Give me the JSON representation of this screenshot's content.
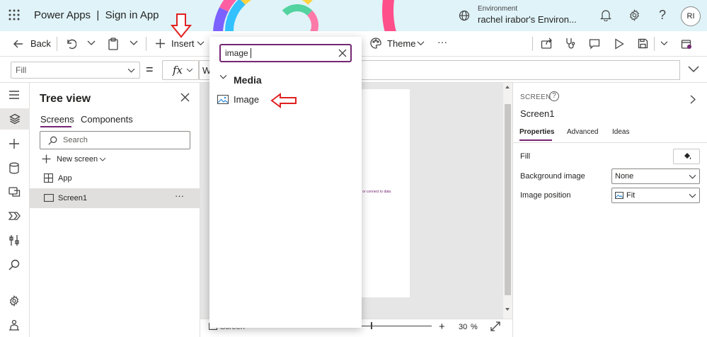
{
  "header": {
    "app_title": "Power Apps  |  Sign in App",
    "environment_label": "Environment",
    "environment_name": "rachel irabor's Environ...",
    "help": "?",
    "avatar_initials": "RI"
  },
  "toolbar": {
    "back_label": "Back",
    "insert_label": "Insert",
    "theme_label": "Theme",
    "more": "···"
  },
  "formula_bar": {
    "property": "Fill",
    "equals": "=",
    "fx": "fx",
    "formula_value": "Wh"
  },
  "tree_view": {
    "title": "Tree view",
    "tabs": [
      {
        "label": "Screens"
      },
      {
        "label": "Components"
      }
    ],
    "search_placeholder": "Search",
    "new_screen_label": "New screen",
    "items": [
      {
        "label": "App"
      },
      {
        "label": "Screen1"
      }
    ],
    "item_more": "···"
  },
  "insert_panel": {
    "search_value": "image",
    "category": "Media",
    "result": "Image"
  },
  "canvas": {
    "hint_text": "e or connect to data",
    "bottom_label": "Screen",
    "zoom_value": "30",
    "zoom_unit": "%"
  },
  "properties_panel": {
    "kind": "SCREEN",
    "name": "Screen1",
    "tabs": [
      {
        "label": "Properties"
      },
      {
        "label": "Advanced"
      },
      {
        "label": "Ideas"
      }
    ],
    "rows": [
      {
        "label": "Fill"
      },
      {
        "label": "Background image",
        "value": "None"
      },
      {
        "label": "Image position",
        "value": "Fit"
      }
    ]
  },
  "colors": {
    "accent": "#742774",
    "annotation_red": "#e02020",
    "header_bg": "#dff3f8"
  }
}
